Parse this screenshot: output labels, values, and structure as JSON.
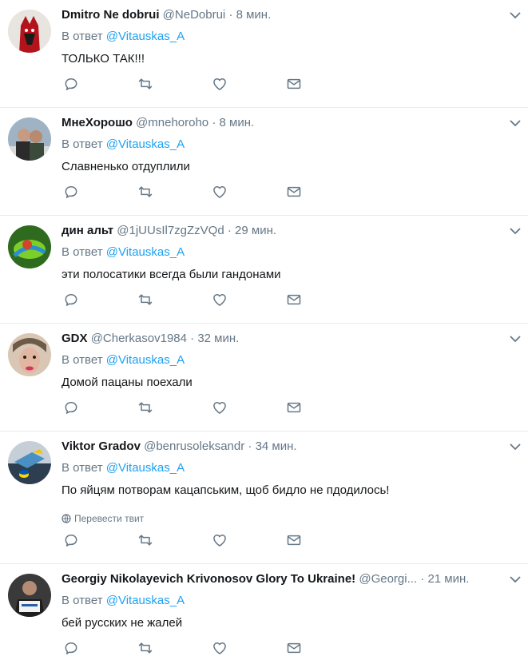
{
  "reply_prefix": "В ответ",
  "translate_label": "Перевести твит",
  "tweets": [
    {
      "name": "Dmitro Ne dobrui",
      "handle": "@NeDobrui",
      "dot": "·",
      "time": "8 мин.",
      "mention": "@Vitauskas_A",
      "text": "ТОЛЬКО ТАК!!!"
    },
    {
      "name": "МнеХорошо",
      "handle": "@mnehoroho",
      "dot": "·",
      "time": "8 мин.",
      "mention": "@Vitauskas_A",
      "text": "Славненько отдуплили"
    },
    {
      "name": "дин альт",
      "handle": "@1jUUsIl7zgZzVQd",
      "dot": "·",
      "time": "29 мин.",
      "mention": "@Vitauskas_A",
      "text": "эти полосатики всегда были гандонами"
    },
    {
      "name": "GDX",
      "handle": "@Cherkasov1984",
      "dot": "·",
      "time": "32 мин.",
      "mention": "@Vitauskas_A",
      "text": "Домой пацаны поехали"
    },
    {
      "name": "Viktor Gradov",
      "handle": "@benrusoleksandr",
      "dot": "·",
      "time": "34 мин.",
      "mention": "@Vitauskas_A",
      "text": "По яйцям потворам кацапським, щоб бидло не пдодилось!"
    },
    {
      "name": "Georgiy Nikolayevich Krivonosov Glory To Ukraine!",
      "handle": "@Georgi...",
      "dot": "·",
      "time": "21 мин.",
      "mention": "@Vitauskas_A",
      "text": "бей русских не жалей"
    }
  ],
  "colors": {
    "accent": "#1da1f2",
    "secondary_text": "#657786",
    "primary_text": "#14171a",
    "divider": "#e6ecf0"
  },
  "icons": [
    "reply-icon",
    "retweet-icon",
    "like-icon",
    "direct-message-icon",
    "chevron-down-icon",
    "globe-icon"
  ]
}
